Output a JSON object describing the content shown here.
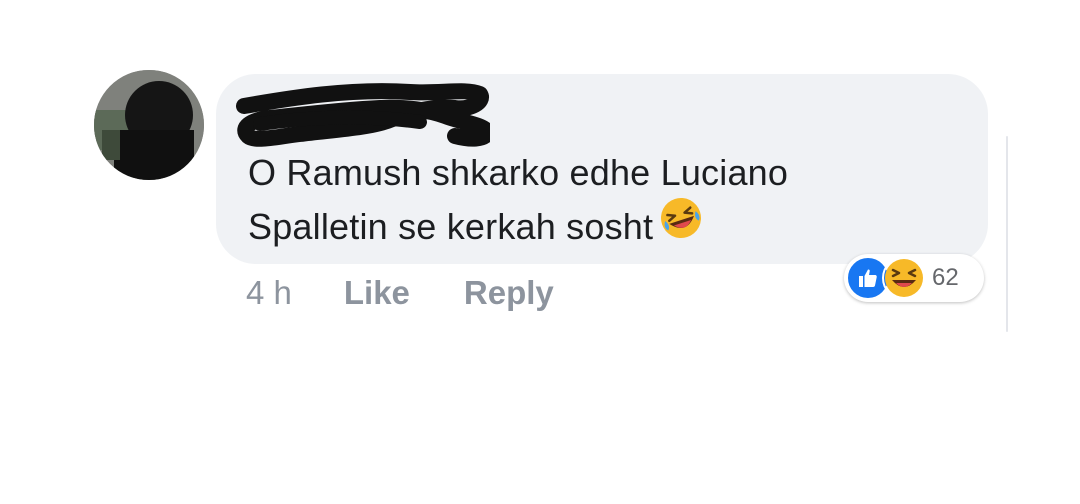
{
  "comment": {
    "text_line1": "O Ramush shkarko edhe Luciano",
    "text_line2": "Spalletin se kerkah sosht",
    "emoji": "rolling-on-the-floor-laughing"
  },
  "actions": {
    "time": "4 h",
    "like_label": "Like",
    "reply_label": "Reply"
  },
  "reactions": {
    "types": [
      "like",
      "haha"
    ],
    "count": "62"
  },
  "colors": {
    "bubble_bg": "#f0f2f5",
    "text": "#1c1e21",
    "secondary_text": "#8d949e",
    "like_blue": "#1877f2",
    "haha_yellow": "#f7b928"
  }
}
